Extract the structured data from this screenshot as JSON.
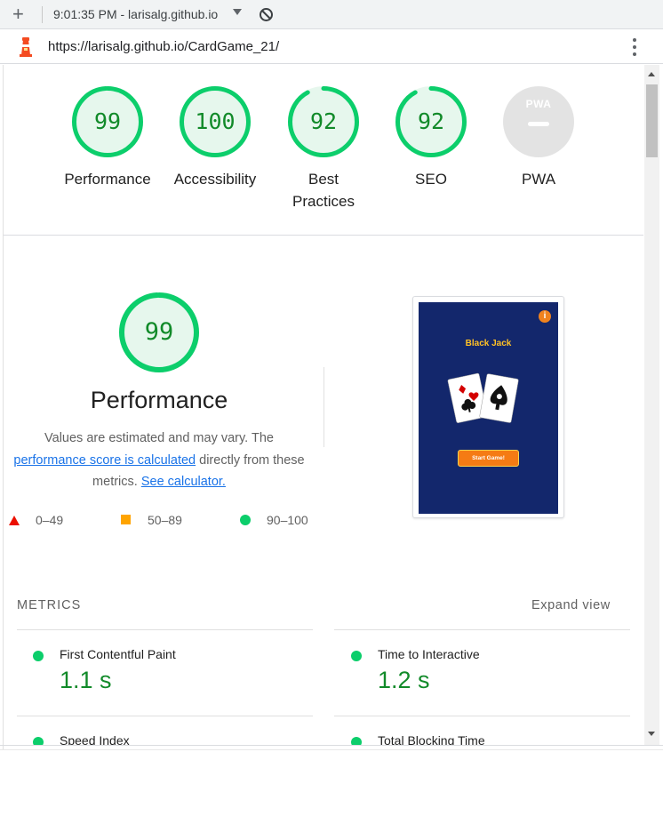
{
  "browser": {
    "time_title": "9:01:35 PM - larisalg.github.io",
    "url": "https://larisalg.github.io/CardGame_21/"
  },
  "summary": [
    {
      "label": "Performance",
      "score": "99",
      "value": 99
    },
    {
      "label": "Accessibility",
      "score": "100",
      "value": 100
    },
    {
      "label": "Best Practices",
      "score": "92",
      "value": 92
    },
    {
      "label": "SEO",
      "score": "92",
      "value": 92
    },
    {
      "label": "PWA",
      "badge": "PWA"
    }
  ],
  "performance": {
    "score": "99",
    "value": 99,
    "title": "Performance",
    "desc_prefix": "Values are estimated and may vary. The",
    "link_text": "performance score is calculated",
    "desc_middle": "directly from these metrics.",
    "calc_link": "See calculator.",
    "legend": [
      {
        "range": "0–49",
        "color": "#eb0f00"
      },
      {
        "range": "50–89",
        "color": "#ffa400"
      },
      {
        "range": "90–100",
        "color": "#0cce6b"
      }
    ]
  },
  "screenshot": {
    "app_title": "Black Jack",
    "button": "Start Game!",
    "info_icon": "i"
  },
  "metrics": {
    "heading": "METRICS",
    "expand": "Expand view",
    "items": [
      {
        "name": "First Contentful Paint",
        "value": "1.1 s"
      },
      {
        "name": "Time to Interactive",
        "value": "1.2 s"
      },
      {
        "name": "Speed Index",
        "value": ""
      },
      {
        "name": "Total Blocking Time",
        "value": ""
      }
    ]
  },
  "colors": {
    "pass": "#0cce6b",
    "pass_text": "#118a29",
    "pass_bg": "#e6f7ed",
    "link": "#1a73e8"
  }
}
